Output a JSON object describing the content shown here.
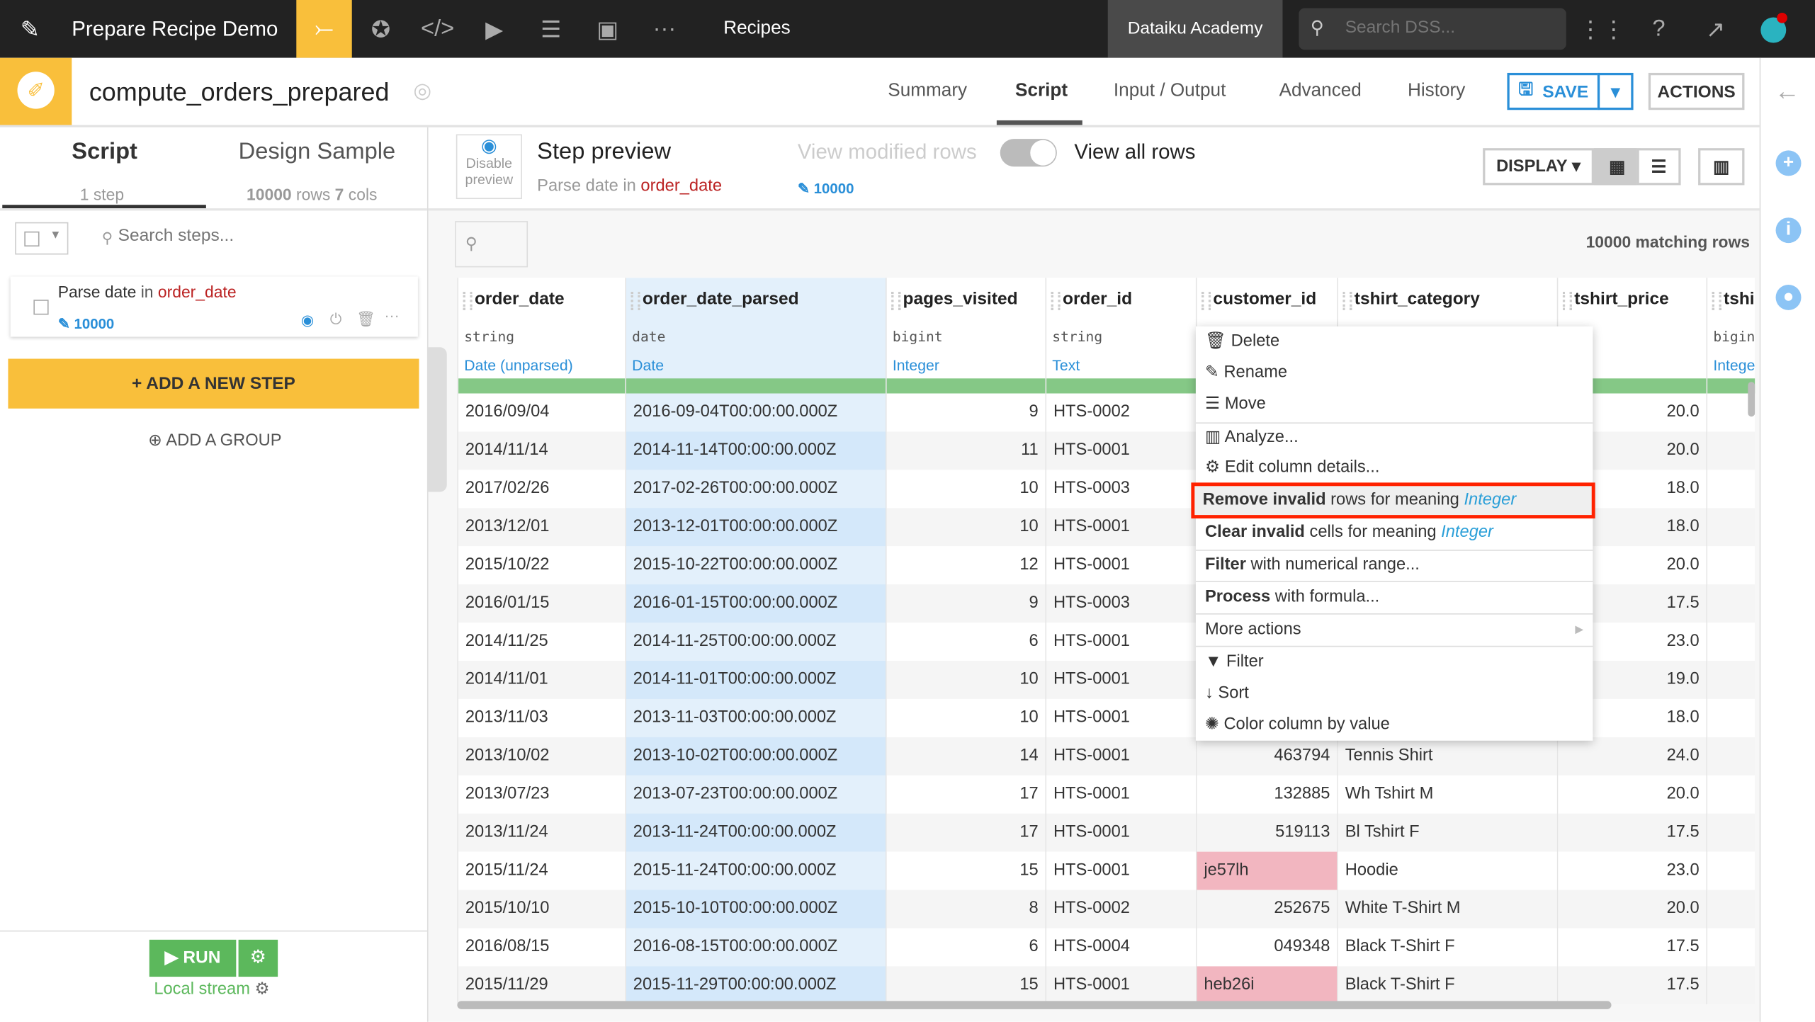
{
  "topbar": {
    "project": "Prepare Recipe Demo",
    "section": "Recipes",
    "academy": "Dataiku Academy",
    "search_placeholder": "Search DSS...",
    "icons": [
      "flow-icon",
      "lab-icon",
      "code-icon",
      "run-icon",
      "notebook-icon",
      "dashboard-icon",
      "more-icon"
    ]
  },
  "recipe": {
    "name": "compute_orders_prepared",
    "tabs": [
      "Summary",
      "Script",
      "Input / Output",
      "Advanced",
      "History"
    ],
    "active_tab": "Script",
    "save": "SAVE",
    "actions": "ACTIONS"
  },
  "left": {
    "tab_script": "Script",
    "tab_sample": "Design Sample",
    "steps_count": "1 step",
    "sample_rows": "10000",
    "sample_rows_label": "rows",
    "sample_cols": "7",
    "sample_cols_label": "cols",
    "search_placeholder": "Search steps...",
    "step": {
      "prefix": "Parse date",
      "in": "in",
      "column": "order_date",
      "count": "10000"
    },
    "add_step": "+ ADD A NEW STEP",
    "add_group": "ADD A GROUP",
    "run": "RUN",
    "engine": "Local stream"
  },
  "preview": {
    "disable1": "Disable",
    "disable2": "preview",
    "title": "Step preview",
    "sub_prefix": "Parse date",
    "sub_in": "in",
    "sub_col": "order_date",
    "count": "10000",
    "view_modified": "View modified rows",
    "view_all": "View all rows",
    "display": "DISPLAY",
    "matching": "10000 matching rows"
  },
  "columns": [
    {
      "name": "order_date",
      "type": "string",
      "meaning": "Date (unparsed)"
    },
    {
      "name": "order_date_parsed",
      "type": "date",
      "meaning": "Date"
    },
    {
      "name": "pages_visited",
      "type": "bigint",
      "meaning": "Integer"
    },
    {
      "name": "order_id",
      "type": "string",
      "meaning": "Text"
    },
    {
      "name": "customer_id",
      "type": "",
      "meaning": ""
    },
    {
      "name": "tshirt_category",
      "type": "",
      "meaning": ""
    },
    {
      "name": "tshirt_price",
      "type": "ble",
      "meaning": "mal"
    },
    {
      "name": "tshi",
      "type": "bigin",
      "meaning": "Integer"
    }
  ],
  "rows": [
    [
      "2016/09/04",
      "2016-09-04T00:00:00.000Z",
      "9",
      "HTS-0002",
      "",
      "",
      "20.0"
    ],
    [
      "2014/11/14",
      "2014-11-14T00:00:00.000Z",
      "11",
      "HTS-0001",
      "",
      "",
      "20.0"
    ],
    [
      "2017/02/26",
      "2017-02-26T00:00:00.000Z",
      "10",
      "HTS-0003",
      "",
      "",
      "18.0"
    ],
    [
      "2013/12/01",
      "2013-12-01T00:00:00.000Z",
      "10",
      "HTS-0001",
      "",
      "",
      "18.0"
    ],
    [
      "2015/10/22",
      "2015-10-22T00:00:00.000Z",
      "12",
      "HTS-0001",
      "",
      "",
      "20.0"
    ],
    [
      "2016/01/15",
      "2016-01-15T00:00:00.000Z",
      "9",
      "HTS-0003",
      "",
      "",
      "17.5"
    ],
    [
      "2014/11/25",
      "2014-11-25T00:00:00.000Z",
      "6",
      "HTS-0001",
      "",
      "",
      "23.0"
    ],
    [
      "2014/11/01",
      "2014-11-01T00:00:00.000Z",
      "10",
      "HTS-0001",
      "",
      "",
      "19.0"
    ],
    [
      "2013/11/03",
      "2013-11-03T00:00:00.000Z",
      "10",
      "HTS-0001",
      "",
      "",
      "18.0"
    ],
    [
      "2013/10/02",
      "2013-10-02T00:00:00.000Z",
      "14",
      "HTS-0001",
      "463794",
      "Tennis Shirt",
      "24.0"
    ],
    [
      "2013/07/23",
      "2013-07-23T00:00:00.000Z",
      "17",
      "HTS-0001",
      "132885",
      "Wh Tshirt M",
      "20.0"
    ],
    [
      "2013/11/24",
      "2013-11-24T00:00:00.000Z",
      "17",
      "HTS-0001",
      "519113",
      "Bl Tshirt F",
      "17.5"
    ],
    [
      "2015/11/24",
      "2015-11-24T00:00:00.000Z",
      "15",
      "HTS-0001",
      "je57lh",
      "Hoodie",
      "23.0"
    ],
    [
      "2015/10/10",
      "2015-10-10T00:00:00.000Z",
      "8",
      "HTS-0002",
      "252675",
      "White T-Shirt M",
      "20.0"
    ],
    [
      "2016/08/15",
      "2016-08-15T00:00:00.000Z",
      "6",
      "HTS-0004",
      "049348",
      "Black T-Shirt F",
      "17.5"
    ],
    [
      "2015/11/29",
      "2015-11-29T00:00:00.000Z",
      "15",
      "HTS-0001",
      "heb26i",
      "Black T-Shirt F",
      "17.5"
    ]
  ],
  "invalid_cells": [
    "je57lh",
    "heb26i"
  ],
  "menu": {
    "delete": "Delete",
    "rename": "Rename",
    "move": "Move",
    "analyze": "Analyze...",
    "edit": "Edit column details...",
    "remove_b": "Remove invalid",
    "remove_r": "rows for meaning",
    "meaning": "Integer",
    "clear_b": "Clear invalid",
    "clear_r": "cells for meaning",
    "filter_b": "Filter",
    "filter_r": "with numerical range...",
    "process_b": "Process",
    "process_r": "with formula...",
    "more": "More actions",
    "filter": "Filter",
    "sort": "Sort",
    "color": "Color column by value",
    "highlighted": "Remove invalid rows for meaning Integer"
  },
  "colors": {
    "accent": "#f9bf3b",
    "topbar": "#222222",
    "link": "#2a8fd8",
    "highlight_border": "#ff2200",
    "invalid": "#f2b6c0",
    "valid_bar": "#85c886"
  }
}
